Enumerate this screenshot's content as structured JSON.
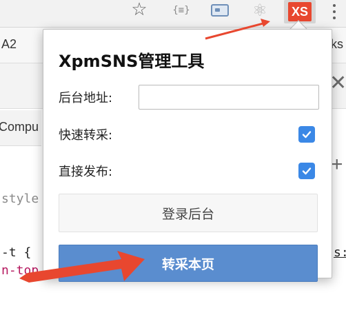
{
  "toolbar": {
    "star_icon": "☆",
    "json_ext_label": "{≡}",
    "react_icon": "⚛",
    "xs_ext_label": "XS"
  },
  "background": {
    "tab_left": "A2",
    "tab_right": "ks",
    "close_icon": "✕",
    "computed_label": "Compu",
    "plus_icon": "+",
    "style_text": "style",
    "code_line_1": "-t {",
    "code_line_2": "n-top",
    "code_right": "s:"
  },
  "popup": {
    "title": "XpmSNS管理工具",
    "address_label": "后台地址:",
    "address_value": "",
    "fast_fetch_label": "快速转采:",
    "fast_fetch_checked": true,
    "direct_publish_label": "直接发布:",
    "direct_publish_checked": true,
    "login_button": "登录后台",
    "fetch_button": "转采本页"
  },
  "colors": {
    "accent_blue": "#5a8dcf",
    "checkbox_blue": "#3b88e6",
    "xs_badge": "#e8472f",
    "arrow": "#e8472f"
  }
}
